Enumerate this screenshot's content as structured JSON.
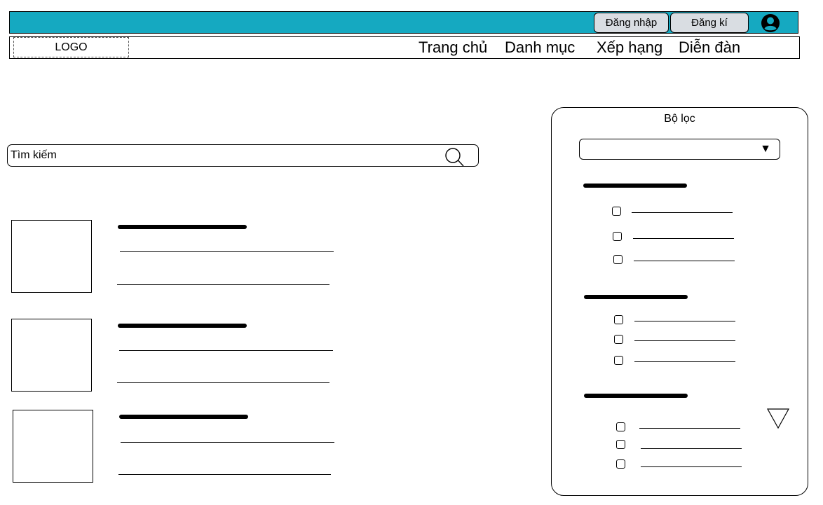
{
  "header": {
    "bar_color": "#15a9c1",
    "login_label": "Đăng nhập",
    "register_label": "Đăng kí",
    "avatar_icon": "user-circle-icon"
  },
  "nav": {
    "logo_label": "LOGO",
    "items": [
      {
        "label": "Trang chủ"
      },
      {
        "label": "Danh mục"
      },
      {
        "label": "Xếp hạng"
      },
      {
        "label": "Diễn đàn"
      }
    ]
  },
  "search": {
    "placeholder": "Tìm kiếm",
    "icon": "search-icon"
  },
  "results": {
    "count": 3
  },
  "filter": {
    "title": "Bộ lọc",
    "select_arrow": "▼",
    "groups": [
      {
        "option_count": 3
      },
      {
        "option_count": 3
      },
      {
        "option_count": 3
      }
    ],
    "scroll_icon": "triangle-down-icon"
  }
}
